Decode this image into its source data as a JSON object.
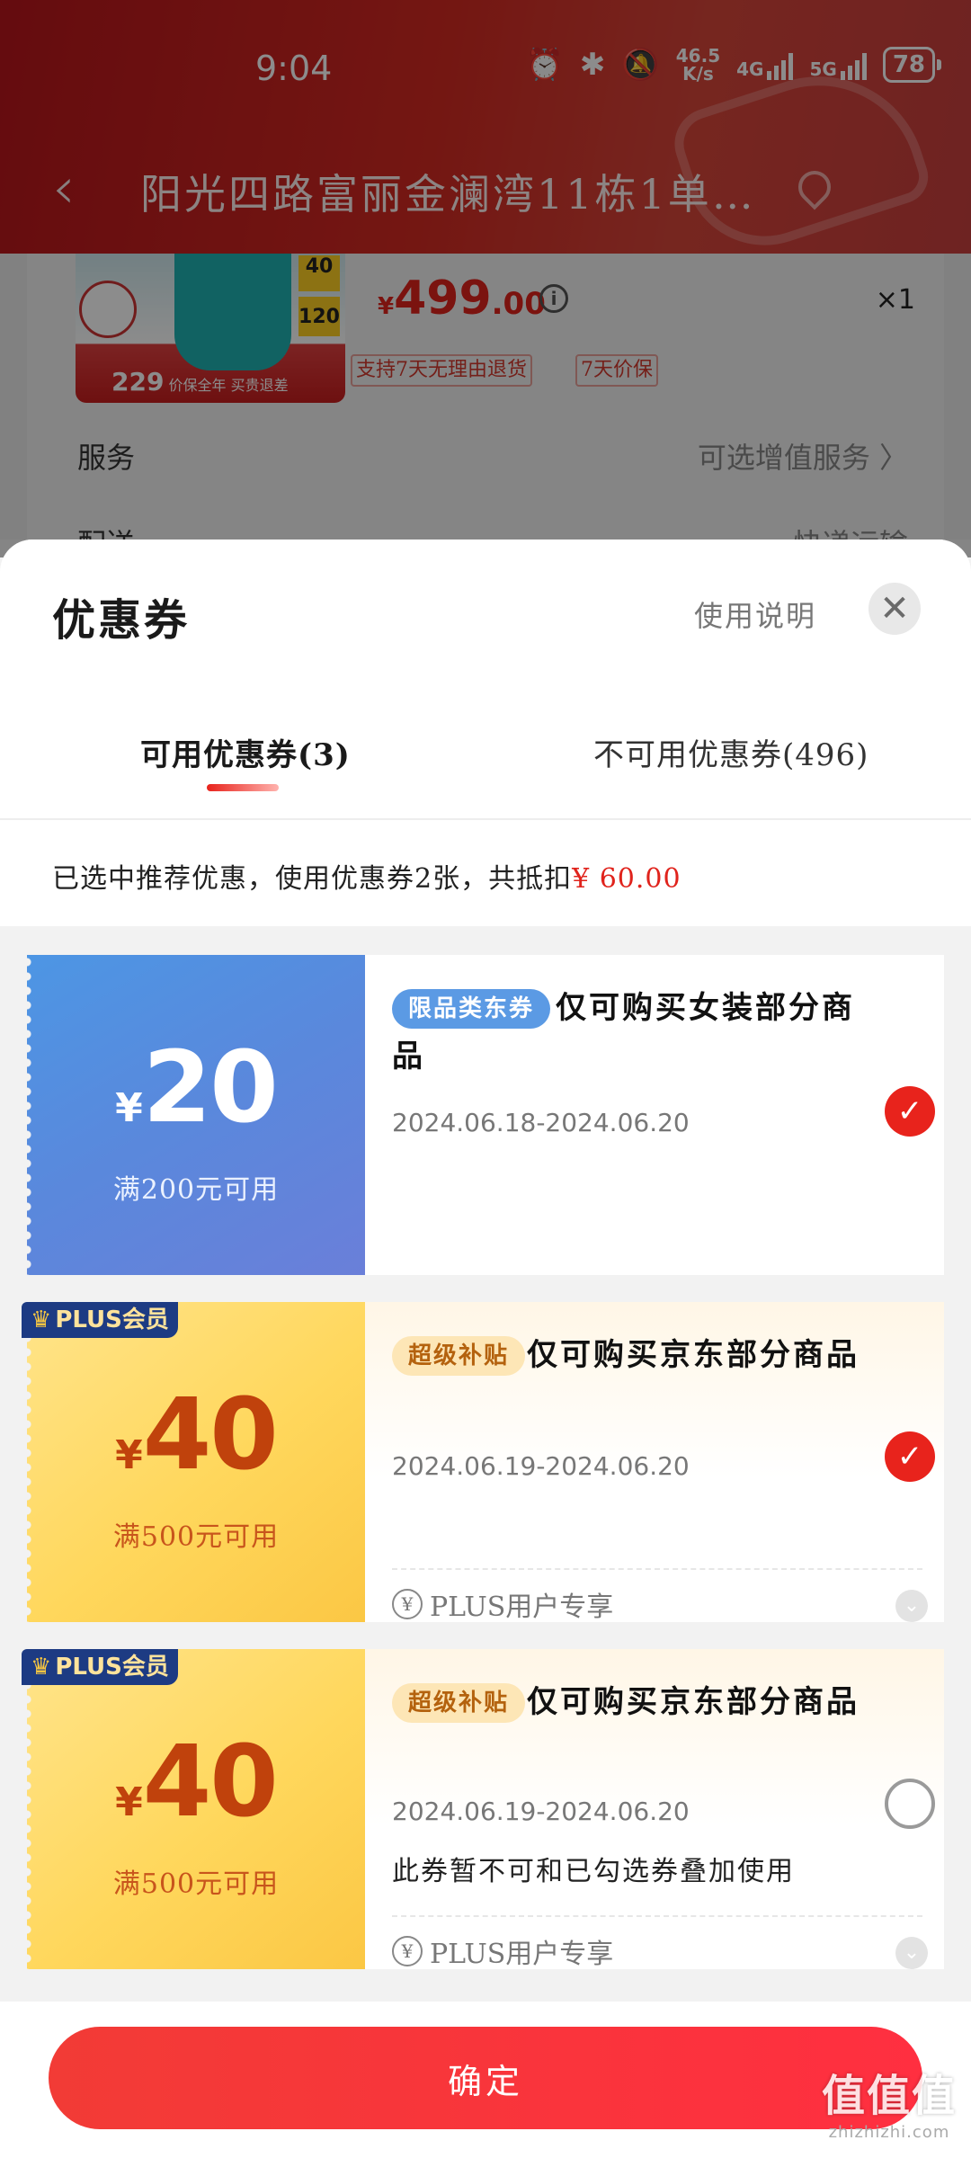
{
  "status_bar": {
    "time": "9:04",
    "net_speed_value": "46.5",
    "net_speed_unit": "K/s",
    "sim1": "4G",
    "sim2": "5G",
    "battery": "78"
  },
  "nav": {
    "address": "阳光四路富丽金澜湾11栋1单…"
  },
  "product": {
    "price_symbol": "¥",
    "price_int": "499",
    "price_dec": ".00",
    "quantity": "×1",
    "image_tag_1": "40",
    "image_tag_2": "120",
    "image_bottom_price": "229",
    "image_bottom_text": "价保全年 买贵退差",
    "service_tags": [
      "支持7天无理由退货",
      "7天价保"
    ]
  },
  "order_rows": {
    "service_label": "服务",
    "service_value": "可选增值服务 〉",
    "delivery_label": "配送",
    "delivery_value": "快递运输"
  },
  "sheet": {
    "title": "优惠券",
    "usage_link": "使用说明",
    "tabs": [
      {
        "label": "可用优惠券(3)"
      },
      {
        "label": "不可用优惠券(496)"
      }
    ],
    "summary_text": "已选中推荐优惠，使用优惠券2张，共抵扣",
    "summary_amount": "¥ 60.00"
  },
  "coupons": [
    {
      "yen": "¥",
      "value": "20",
      "condition": "满200元可用",
      "tag": "限品类东券",
      "desc_line1": "仅可购买女装部分商",
      "desc_line2": "品",
      "date": "2024.06.18-2024.06.20",
      "selected": true
    },
    {
      "badge": "PLUS会员",
      "yen": "¥",
      "value": "40",
      "condition": "满500元可用",
      "tag": "超级补贴",
      "desc": "仅可购买京东部分商品",
      "date": "2024.06.19-2024.06.20",
      "plus_only": "PLUS用户专享",
      "selected": true
    },
    {
      "badge": "PLUS会员",
      "yen": "¥",
      "value": "40",
      "condition": "满500元可用",
      "tag": "超级补贴",
      "desc": "仅可购买京东部分商品",
      "date": "2024.06.19-2024.06.20",
      "note": "此券暂不可和已勾选券叠加使用",
      "plus_only": "PLUS用户专享",
      "selected": false
    }
  ],
  "footer": {
    "confirm_label": "确定"
  },
  "watermark": {
    "logo_text": "值值值",
    "domain": "zhizhizhi.com"
  },
  "colors": {
    "brand_red": "#e0231c",
    "header_red": "#c8201f",
    "blue_coupon": "#5a88dc",
    "gold_coupon": "#ffd75c"
  }
}
